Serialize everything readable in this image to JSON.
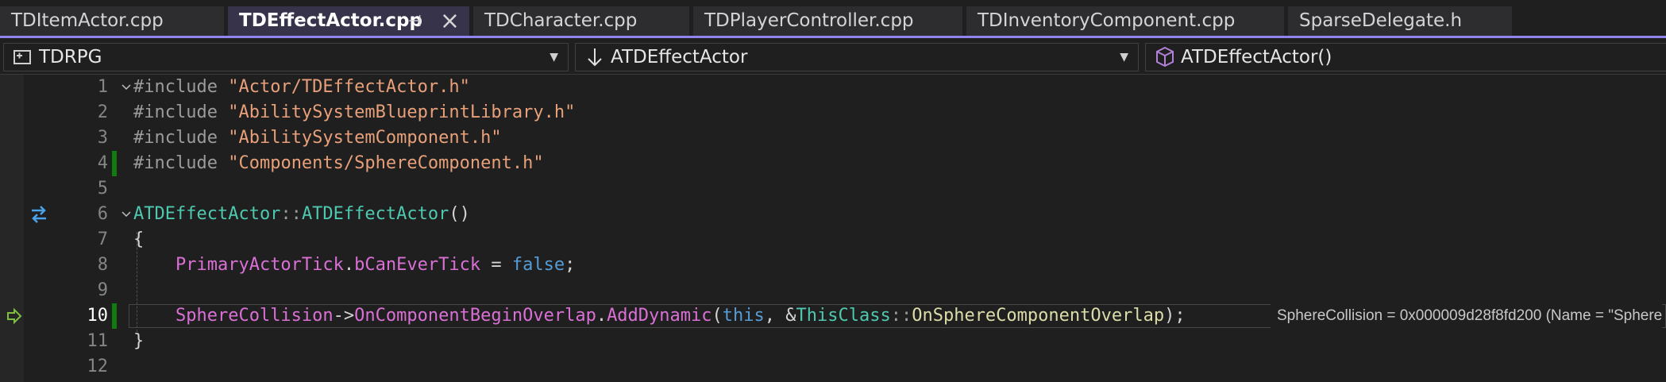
{
  "tabs": [
    {
      "label": "TDItemActor.cpp"
    },
    {
      "label": "TDEffectActor.cpp",
      "active": true
    },
    {
      "label": "TDCharacter.cpp"
    },
    {
      "label": "TDPlayerController.cpp"
    },
    {
      "label": "TDInventoryComponent.cpp"
    },
    {
      "label": "SparseDelegate.h"
    }
  ],
  "navbar": {
    "project": "TDRPG",
    "scope": "ATDEffectActor",
    "member": "ATDEffectActor()"
  },
  "editor": {
    "current_line": 10,
    "lines": [
      {
        "n": "1"
      },
      {
        "n": "2"
      },
      {
        "n": "3"
      },
      {
        "n": "4"
      },
      {
        "n": "5"
      },
      {
        "n": "6"
      },
      {
        "n": "7"
      },
      {
        "n": "8"
      },
      {
        "n": "9"
      },
      {
        "n": "10"
      },
      {
        "n": "11"
      },
      {
        "n": "12"
      }
    ],
    "tokens": {
      "l1": [
        "#include ",
        "\"Actor/TDEffectActor.h\""
      ],
      "l2": [
        "#include ",
        "\"AbilitySystemBlueprintLibrary.h\""
      ],
      "l3": [
        "#include ",
        "\"AbilitySystemComponent.h\""
      ],
      "l4": [
        "#include ",
        "\"Components/SphereComponent.h\""
      ],
      "l6": [
        "ATDEffectActor",
        "::",
        "ATDEffectActor",
        "()"
      ],
      "l7": [
        "{"
      ],
      "l8": [
        "    ",
        "PrimaryActorTick",
        ".",
        "bCanEverTick",
        " = ",
        "false",
        ";"
      ],
      "l10": [
        "    ",
        "SphereCollision",
        "->",
        "OnComponentBeginOverlap",
        ".",
        "AddDynamic",
        "(",
        "this",
        ", &",
        "ThisClass",
        "::",
        "OnSphereComponentOverlap",
        ");"
      ],
      "l11": [
        "}"
      ]
    },
    "datatip": "SphereCollision = 0x000009d28f8fd200 (Name = \"Sphere"
  },
  "colors": {
    "accent": "#9184ee",
    "change_bar": "#107c10"
  }
}
